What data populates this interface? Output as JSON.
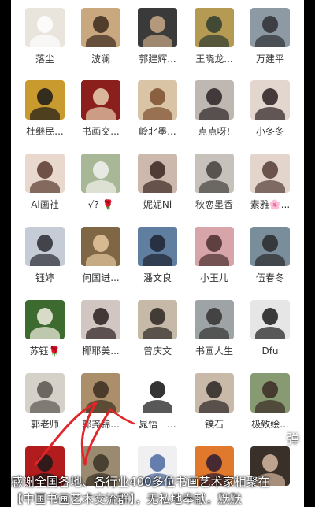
{
  "contacts": [
    {
      "name": "落尘",
      "icon": "dog-avatar-icon",
      "bg": "#e9e4dc",
      "fg": "#ffffff"
    },
    {
      "name": "波澜",
      "icon": "cartoon-girl-avatar-icon",
      "bg": "#c9a880",
      "fg": "#3b2a1c"
    },
    {
      "name": "郭建辉...",
      "icon": "man-portrait-avatar-icon",
      "bg": "#3a3a3a",
      "fg": "#c9a988"
    },
    {
      "name": "王晓龙...",
      "icon": "sunset-silhouette-avatar-icon",
      "bg": "#b59a54",
      "fg": "#2e3b2f"
    },
    {
      "name": "万建平",
      "icon": "man-portrait-avatar-icon",
      "bg": "#8d9aa3",
      "fg": "#2f2f35"
    },
    {
      "name": "杜继民...",
      "icon": "calligraphy-avatar-icon",
      "bg": "#c99a2e",
      "fg": "#1a1a1a"
    },
    {
      "name": "书画交...",
      "icon": "red-flowers-avatar-icon",
      "bg": "#8a1f1c",
      "fg": "#e8d2b0"
    },
    {
      "name": "岭北墨...",
      "icon": "painting-avatar-icon",
      "bg": "#d9c4a5",
      "fg": "#7b4f2e"
    },
    {
      "name": "点点呀!",
      "icon": "woman-portrait-avatar-icon",
      "bg": "#bfb7b2",
      "fg": "#2b2325"
    },
    {
      "name": "小冬冬",
      "icon": "woman-portrait-avatar-icon",
      "bg": "#e3d6cf",
      "fg": "#2a2020"
    },
    {
      "name": "Ai画社",
      "icon": "woman-portrait-avatar-icon",
      "bg": "#e8d8cd",
      "fg": "#5a3a30"
    },
    {
      "name": "√? 🌹",
      "icon": "woman-garden-avatar-icon",
      "bg": "#a8b897",
      "fg": "#f2f2ee"
    },
    {
      "name": "妮妮Ni",
      "icon": "woman-portrait-avatar-icon",
      "bg": "#cdb8ad",
      "fg": "#3a2620"
    },
    {
      "name": "秋恋墨香",
      "icon": "couple-avatar-icon",
      "bg": "#c6c2bb",
      "fg": "#45403c"
    },
    {
      "name": "素雅🌸...",
      "icon": "woman-portrait-avatar-icon",
      "bg": "#e4d5cc",
      "fg": "#533c34"
    },
    {
      "name": "钰婷",
      "icon": "woman-portrait-avatar-icon",
      "bg": "#c5ccd6",
      "fg": "#2a2a33"
    },
    {
      "name": "何国进...",
      "icon": "man-portrait-avatar-icon",
      "bg": "#7f6645",
      "fg": "#e6c9a0"
    },
    {
      "name": "潘文良",
      "icon": "man-suit-avatar-icon",
      "bg": "#5f7ea0",
      "fg": "#1e2330"
    },
    {
      "name": "小玉儿",
      "icon": "woman-flowers-avatar-icon",
      "bg": "#d6a4a9",
      "fg": "#4a2f2f"
    },
    {
      "name": "伍春冬",
      "icon": "man-mountain-avatar-icon",
      "bg": "#7a8d9a",
      "fg": "#2a2a2a"
    },
    {
      "name": "苏钰🌹",
      "icon": "lotus-avatar-icon",
      "bg": "#3d6b2f",
      "fg": "#f3efe2"
    },
    {
      "name": "椰耶美...",
      "icon": "woman-portrait-avatar-icon",
      "bg": "#d2c6c2",
      "fg": "#2a1f1f"
    },
    {
      "name": "曾庆文",
      "icon": "man-writing-avatar-icon",
      "bg": "#c7b9a8",
      "fg": "#2b2622"
    },
    {
      "name": "书画人生",
      "icon": "photographers-avatar-icon",
      "bg": "#9ea3a6",
      "fg": "#333333"
    },
    {
      "name": "Dfu",
      "icon": "penguin-avatar-icon",
      "bg": "#e6e6e6",
      "fg": "#1b1b1b"
    },
    {
      "name": "郭老师",
      "icon": "sketch-portrait-avatar-icon",
      "bg": "#d5d0c8",
      "fg": "#5a5550"
    },
    {
      "name": "郭尧锦...",
      "icon": "dog-statue-avatar-icon",
      "bg": "#ab8f6a",
      "fg": "#3a2d1f"
    },
    {
      "name": "晁悟一...",
      "icon": "seal-logo-avatar-icon",
      "bg": "#ffffff",
      "fg": "#111111"
    },
    {
      "name": "镤石",
      "icon": "man-portrait-avatar-icon",
      "bg": "#c8b9a9",
      "fg": "#2a2424"
    },
    {
      "name": "极致绘...",
      "icon": "group-photo-avatar-icon",
      "bg": "#879a72",
      "fg": "#3b2a25"
    },
    {
      "name": "",
      "icon": "man-red-background-avatar-icon",
      "bg": "#b21c1c",
      "fg": "#1a1a1a"
    },
    {
      "name": "",
      "icon": "artwork-avatar-icon",
      "bg": "#9a8a6f",
      "fg": "#3a3226"
    },
    {
      "name": "",
      "icon": "anime-character-avatar-icon",
      "bg": "#f0f0f3",
      "fg": "#4c6aa0"
    },
    {
      "name": "",
      "icon": "sunset-avatar-icon",
      "bg": "#e0792c",
      "fg": "#2b1c33"
    },
    {
      "name": "",
      "icon": "woman-portrait-avatar-icon",
      "bg": "#3a302a",
      "fg": "#d6b8a0"
    }
  ],
  "overlay": {
    "line1": "感谢全国各地、各行业400多位书画艺术家相聚在",
    "line2": "【中国书画艺术交流群】，无私地奉献，默默",
    "dan": "弹"
  }
}
